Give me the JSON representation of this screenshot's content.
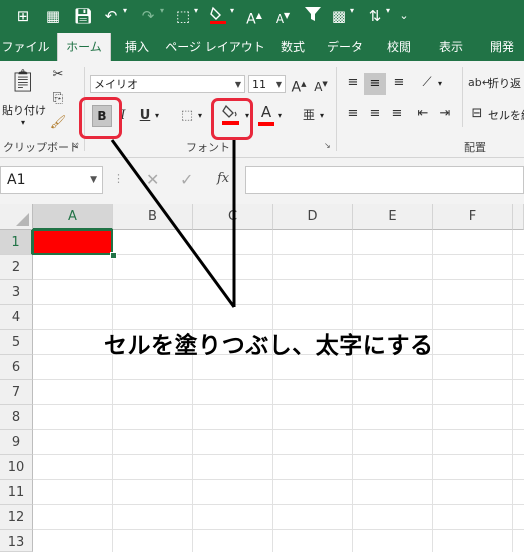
{
  "qat": {
    "icons": [
      "table-icon",
      "grid-icon",
      "save-icon",
      "undo-icon",
      "redo-icon",
      "borders-icon",
      "fill-color-icon",
      "font-increase-icon",
      "font-decrease-icon",
      "filter-icon",
      "pivot-icon",
      "sort-icon",
      "more-icon"
    ]
  },
  "tabs": [
    "ファイル",
    "ホーム",
    "挿入",
    "ページ レイアウト",
    "数式",
    "データ",
    "校閲",
    "表示",
    "開発"
  ],
  "active_tab": "ホーム",
  "ribbon": {
    "paste_label": "貼り付け",
    "clipboard_group": "クリップボード",
    "font_name": "メイリオ",
    "font_size": "11",
    "bold": "B",
    "italic": "I",
    "underline": "U",
    "font_color_glyph": "A",
    "font_group": "フォント",
    "wrap_text": "折り返",
    "merge_cells": "セルを結",
    "alignment_group": "配置",
    "fill_color": "#ff0000",
    "font_color": "#ff0000"
  },
  "formula_bar": {
    "name_box": "A1",
    "fx": "fx",
    "value": ""
  },
  "grid": {
    "columns": [
      "A",
      "B",
      "C",
      "D",
      "E",
      "F"
    ],
    "rows": [
      "1",
      "2",
      "3",
      "4",
      "5",
      "6",
      "7",
      "8",
      "9",
      "10",
      "11",
      "12",
      "13"
    ],
    "selected_cell": "A1",
    "selected_cell_fill": "#ff0000"
  },
  "annotation": {
    "text": "セルを塗りつぶし、太字にする",
    "highlight_color": "#e8283c"
  }
}
